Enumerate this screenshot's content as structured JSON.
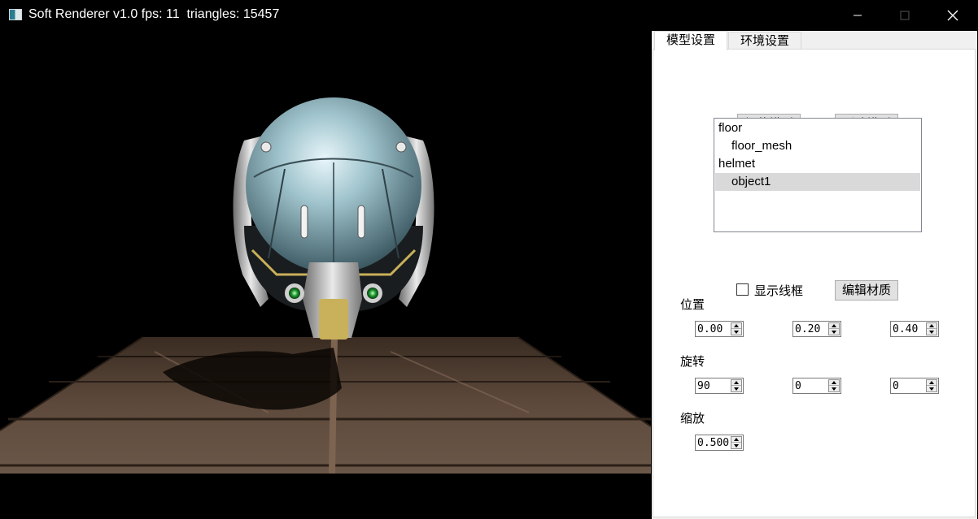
{
  "window": {
    "title": "Soft Renderer v1.0 fps: 11  triangles: 15457"
  },
  "tabs": [
    {
      "label": "模型设置",
      "active": true
    },
    {
      "label": "环境设置",
      "active": false
    }
  ],
  "buttons": {
    "load_model": "加载模型",
    "delete_model": "删除模型",
    "edit_material": "编辑材质"
  },
  "model_tree": [
    {
      "label": "floor",
      "level": 0,
      "selected": false
    },
    {
      "label": "floor_mesh",
      "level": 1,
      "selected": false
    },
    {
      "label": "helmet",
      "level": 0,
      "selected": false
    },
    {
      "label": "object1",
      "level": 1,
      "selected": true
    }
  ],
  "wireframe": {
    "label": "显示线框",
    "checked": false
  },
  "position": {
    "label": "位置",
    "x": "0.00",
    "y": "0.20",
    "z": "0.40"
  },
  "rotation": {
    "label": "旋转",
    "x": "90",
    "y": "0",
    "z": "0"
  },
  "scale": {
    "label": "缩放",
    "value": "0.500"
  },
  "colors": {
    "titlebar_bg": "#000000",
    "viewport_bg": "#000000",
    "panel_bg": "#ffffff",
    "selection_bg": "#d9d9d9"
  }
}
